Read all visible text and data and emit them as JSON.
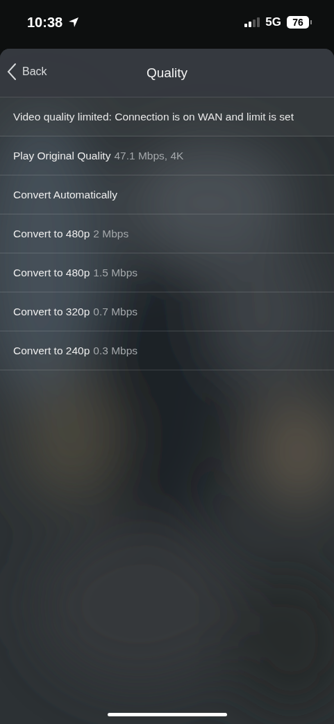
{
  "status_bar": {
    "time": "10:38",
    "network": "5G",
    "battery": "76"
  },
  "nav": {
    "back": "Back",
    "title": "Quality"
  },
  "notice": "Video quality limited: Connection is on WAN and limit is set",
  "options": [
    {
      "label": "Play Original Quality",
      "detail": "47.1 Mbps, 4K"
    },
    {
      "label": "Convert Automatically"
    },
    {
      "label": "Convert to 480p",
      "detail": "2 Mbps"
    },
    {
      "label": "Convert to 480p",
      "detail": "1.5 Mbps"
    },
    {
      "label": "Convert to 320p",
      "detail": "0.7 Mbps"
    },
    {
      "label": "Convert to 240p",
      "detail": "0.3 Mbps"
    }
  ]
}
